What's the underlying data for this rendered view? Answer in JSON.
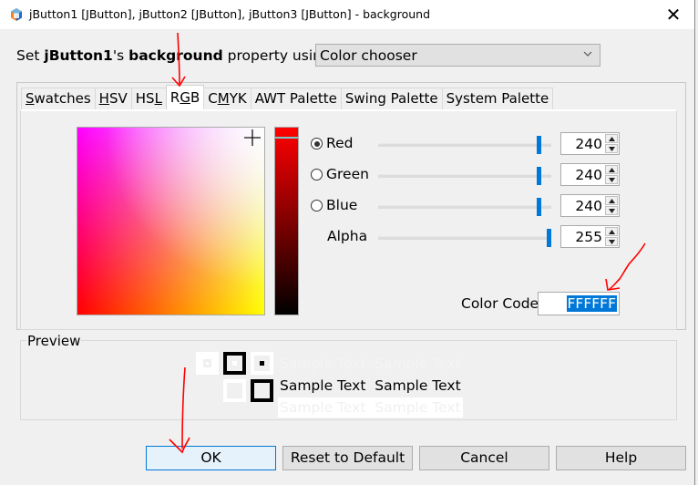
{
  "window": {
    "title": "jButton1 [JButton], jButton2 [JButton], jButton3 [JButton] - background",
    "close_glyph": "✕"
  },
  "prompt": {
    "prefix": "Set ",
    "component": "jButton1",
    "possessive": "'s ",
    "property": "background",
    "suffix": " property using:"
  },
  "editor_select": {
    "value": "Color chooser"
  },
  "tabs": [
    {
      "label": "Swatches",
      "mnemonic_index": 0,
      "active": false
    },
    {
      "label": "HSV",
      "mnemonic_index": 0,
      "active": false
    },
    {
      "label": "HSL",
      "mnemonic_index": 2,
      "active": false
    },
    {
      "label": "RGB",
      "mnemonic_index": 1,
      "active": true
    },
    {
      "label": "CMYK",
      "mnemonic_index": 1,
      "active": false
    },
    {
      "label": "AWT Palette",
      "mnemonic_index": -1,
      "active": false
    },
    {
      "label": "Swing Palette",
      "mnemonic_index": -1,
      "active": false
    },
    {
      "label": "System Palette",
      "mnemonic_index": -1,
      "active": false
    }
  ],
  "rgb": {
    "channels": [
      {
        "label": "Red",
        "value": "240",
        "selected": true,
        "fraction": 0.941
      },
      {
        "label": "Green",
        "value": "240",
        "selected": false,
        "fraction": 0.941
      },
      {
        "label": "Blue",
        "value": "240",
        "selected": false,
        "fraction": 0.941
      }
    ],
    "alpha": {
      "label": "Alpha",
      "value": "255",
      "fraction": 1.0
    },
    "color_code": {
      "label": "Color Code",
      "value": "FFFFFF"
    }
  },
  "preview": {
    "label": "Preview",
    "sample_text": "Sample Text",
    "colors": {
      "foreground": "#000000",
      "background": "#ffffff",
      "light": "#f0f0f0"
    }
  },
  "buttons": {
    "ok": "OK",
    "reset": "Reset to Default",
    "cancel": "Cancel",
    "help": "Help"
  },
  "colors": {
    "accent": "#0078d7",
    "annotation": "#ff0000"
  }
}
